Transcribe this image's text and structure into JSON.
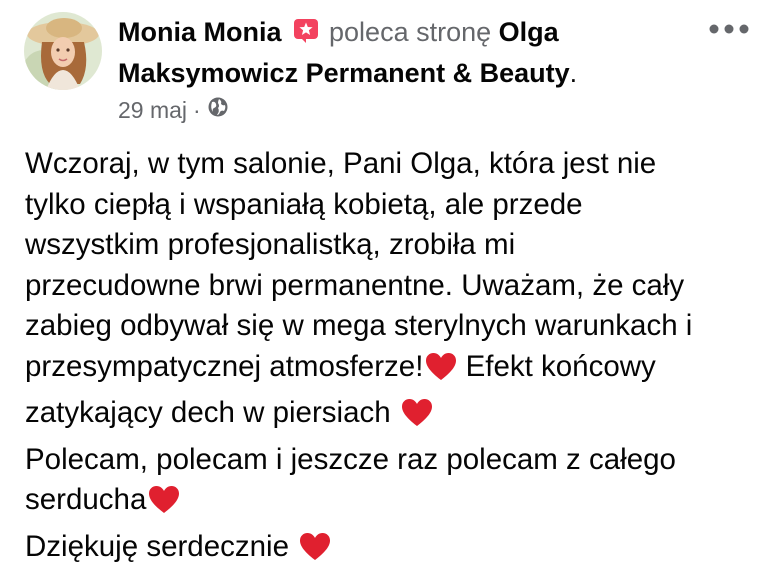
{
  "post": {
    "author": {
      "name": "Monia Monia",
      "badge_icon": "recommend-star-icon"
    },
    "action_text": "poleca stronę",
    "page_name": "Olga Maksymowicz Permanent & Beauty",
    "period": ".",
    "date": "29 maj",
    "separator": "·",
    "privacy_icon": "globe-icon",
    "more_icon": "more-options-icon",
    "body": {
      "line1": "Wczoraj, w tym salonie, Pani Olga, która jest nie",
      "line2": "tylko ciepłą i  wspaniałą kobietą, ale przede",
      "line3": "wszystkim profesjonalistką, zrobiła mi",
      "line4": "przecudowne brwi permanentne. Uważam, że cały",
      "line5": "zabieg odbywał się w mega sterylnych warunkach i",
      "line6a": "przesympatycznej atmosferze!",
      "line6b": " Efekt końcowy",
      "line7": "zatykający dech w piersiach ",
      "line8": "Polecam, polecam i jeszcze raz polecam z całego",
      "line9": "serducha",
      "line10": "Dziękuję serdecznie "
    },
    "emoji": "red-heart",
    "colors": {
      "text": "#050505",
      "secondary": "#65676b",
      "heart": "#e0202f",
      "badge": "#f3425f"
    }
  }
}
